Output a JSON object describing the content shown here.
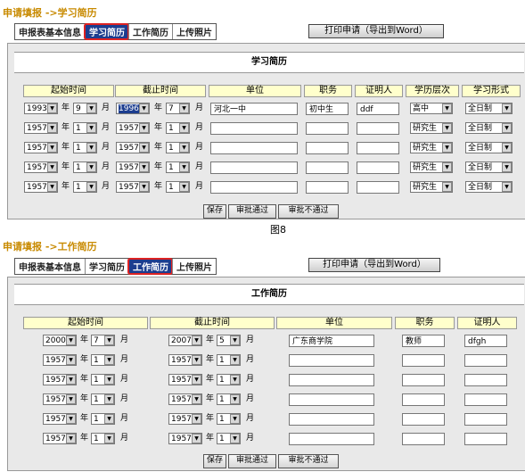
{
  "section1": {
    "breadcrumb": "申请填报 ->学习简历",
    "tabs": [
      "申报表基本信息",
      "学习简历",
      "工作简历",
      "上传照片"
    ],
    "print_label": "打印申请（导出到Word）",
    "panel_title": "学习简历",
    "headers": [
      "起始时间",
      "截止时间",
      "单位",
      "职务",
      "证明人",
      "学历层次",
      "学习形式"
    ],
    "year_label": "年",
    "month_label": "月",
    "rows": [
      {
        "start_year": "1993",
        "start_month": "9",
        "end_year": "1996",
        "end_month": "7",
        "unit": "河北一中",
        "position": "初中生",
        "witness": "ddf",
        "level": "高中",
        "form": "全日制"
      },
      {
        "start_year": "1957",
        "start_month": "1",
        "end_year": "1957",
        "end_month": "1",
        "unit": "",
        "position": "",
        "witness": "",
        "level": "研究生",
        "form": "全日制"
      },
      {
        "start_year": "1957",
        "start_month": "1",
        "end_year": "1957",
        "end_month": "1",
        "unit": "",
        "position": "",
        "witness": "",
        "level": "研究生",
        "form": "全日制"
      },
      {
        "start_year": "1957",
        "start_month": "1",
        "end_year": "1957",
        "end_month": "1",
        "unit": "",
        "position": "",
        "witness": "",
        "level": "研究生",
        "form": "全日制"
      },
      {
        "start_year": "1957",
        "start_month": "1",
        "end_year": "1957",
        "end_month": "1",
        "unit": "",
        "position": "",
        "witness": "",
        "level": "研究生",
        "form": "全日制"
      }
    ],
    "buttons": [
      "保存",
      "审批通过",
      "审批不通过"
    ],
    "caption": "图8"
  },
  "section2": {
    "breadcrumb": "申请填报 ->工作简历",
    "tabs": [
      "申报表基本信息",
      "学习简历",
      "工作简历",
      "上传照片"
    ],
    "print_label": "打印申请（导出到Word）",
    "panel_title": "工作简历",
    "headers": [
      "起始时间",
      "截止时间",
      "单位",
      "职务",
      "证明人"
    ],
    "year_label": "年",
    "month_label": "月",
    "rows": [
      {
        "start_year": "2000",
        "start_month": "7",
        "end_year": "2007",
        "end_month": "5",
        "unit": "广东商学院",
        "position": "教师",
        "witness": "dfgh"
      },
      {
        "start_year": "1957",
        "start_month": "1",
        "end_year": "1957",
        "end_month": "1",
        "unit": "",
        "position": "",
        "witness": ""
      },
      {
        "start_year": "1957",
        "start_month": "1",
        "end_year": "1957",
        "end_month": "1",
        "unit": "",
        "position": "",
        "witness": ""
      },
      {
        "start_year": "1957",
        "start_month": "1",
        "end_year": "1957",
        "end_month": "1",
        "unit": "",
        "position": "",
        "witness": ""
      },
      {
        "start_year": "1957",
        "start_month": "1",
        "end_year": "1957",
        "end_month": "1",
        "unit": "",
        "position": "",
        "witness": ""
      },
      {
        "start_year": "1957",
        "start_month": "1",
        "end_year": "1957",
        "end_month": "1",
        "unit": "",
        "position": "",
        "witness": ""
      }
    ],
    "buttons": [
      "保存",
      "审批通过",
      "审批不通过"
    ]
  }
}
